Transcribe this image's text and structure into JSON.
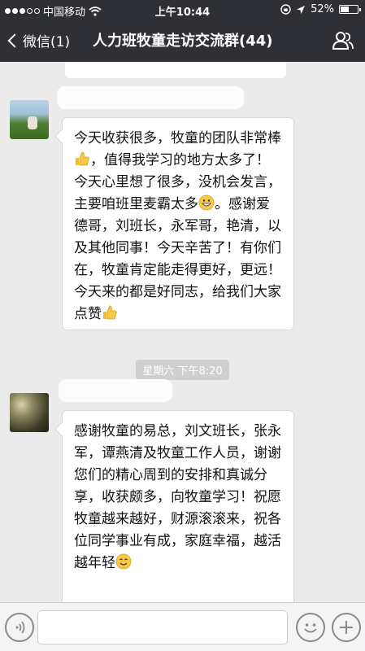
{
  "status_bar": {
    "carrier": "中国移动",
    "time": "上午10:44",
    "battery": "52%",
    "battery_fraction": 0.52
  },
  "nav": {
    "back_label": "微信(1)",
    "title": "人力班牧童走访交流群(44)"
  },
  "messages": [
    {
      "text_parts": [
        "今天收获很多，牧童的团队非常棒",
        "，值得我学习的地方太多了！今天心里想了很多，没机会发言，主要咱班里麦霸太多",
        "。感谢爱德哥，刘班长，永军哥，艳清，以及其他同事！今天辛苦了！有你们在，牧童肯定能走得更好，更远！今天来的都是好同志，给我们大家点赞",
        ""
      ],
      "emojis": [
        "thumbs-up-emoji",
        "grin-emoji",
        "thumbs-up-emoji"
      ]
    },
    {
      "text_parts": [
        "感谢牧童的易总，刘文班长，张永军，谭燕清及牧童工作人员，谢谢您们的精心周到的安排和真诚分享，收获颇多，向牧童学习！祝愿牧童越来越好，财源滚滚来，祝各位同学事业有成，家庭幸福，越活越年轻",
        ""
      ],
      "emojis": [
        "smile-emoji"
      ]
    }
  ],
  "timestamp": "星期六 下午8:20",
  "icons": {
    "back": "chevron-left-icon",
    "group_members": "people-icon",
    "voice": "voice-icon",
    "emoji": "emoji-icon",
    "more": "plus-icon"
  }
}
